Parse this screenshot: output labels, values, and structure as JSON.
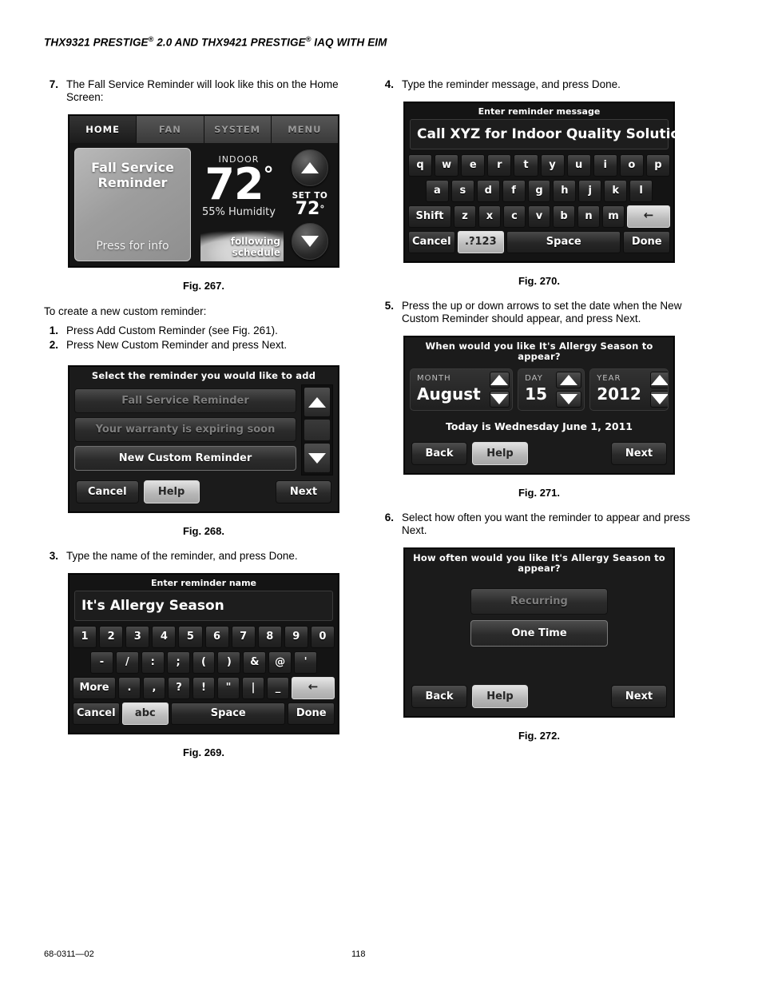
{
  "document": {
    "header": "THX9321 PRESTIGE® 2.0 AND THX9421 PRESTIGE® IAQ WITH EIM",
    "header_part1": "THX9321 PRESTIGE",
    "header_sup1": "®",
    "header_part2": " 2.0 AND THX9421 PRESTIGE",
    "header_sup2": "®",
    "header_part3": " IAQ WITH EIM",
    "footer_code": "68-0311—02",
    "page_number": "118"
  },
  "left_column": {
    "step7": {
      "num": "7.",
      "text": "The Fall Service Reminder will look like this on the Home Screen:"
    },
    "fig267_caption": "Fig. 267.",
    "intro": "To create a new custom reminder:",
    "step1": {
      "num": "1.",
      "text": "Press Add Custom Reminder (see Fig. 261)."
    },
    "step2": {
      "num": "2.",
      "text": "Press New Custom Reminder and press Next."
    },
    "fig268_caption": "Fig. 268.",
    "step3": {
      "num": "3.",
      "text": "Type the name of the reminder, and press Done."
    },
    "fig269_caption": "Fig. 269."
  },
  "right_column": {
    "step4": {
      "num": "4.",
      "text": "Type the reminder message, and press Done."
    },
    "fig270_caption": "Fig. 270.",
    "step5": {
      "num": "5.",
      "text": "Press the up or down arrows to set the date when the New Custom Reminder should appear, and press Next."
    },
    "fig271_caption": "Fig. 271.",
    "step6": {
      "num": "6.",
      "text": "Select how often you want the reminder to appear and press Next."
    },
    "fig272_caption": "Fig. 272."
  },
  "fig267_home_screen": {
    "tabs": [
      {
        "label": "HOME",
        "active": true
      },
      {
        "label": "FAN",
        "active": false
      },
      {
        "label": "SYSTEM",
        "active": false
      },
      {
        "label": "MENU",
        "active": false
      }
    ],
    "reminder_card": {
      "title_line1": "Fall Service",
      "title_line2": "Reminder",
      "action": "Press for info"
    },
    "indoor_label": "INDOOR",
    "temperature": "72",
    "degree": "°",
    "humidity": "55% Humidity",
    "schedule_status": "following schedule",
    "set_to_label": "SET TO",
    "set_to_value": "72",
    "set_to_degree": "°",
    "up_arrow_icon": "triangle-up-icon",
    "down_arrow_icon": "triangle-down-icon"
  },
  "fig268_select_reminder": {
    "title": "Select the reminder you would like to add",
    "items": [
      {
        "label": "Fall Service Reminder",
        "enabled": false
      },
      {
        "label": "Your warranty is expiring soon",
        "enabled": false
      },
      {
        "label": "New Custom Reminder",
        "enabled": true
      }
    ],
    "scroll_up_icon": "scroll-up-icon",
    "scroll_down_icon": "scroll-down-icon",
    "buttons": {
      "cancel": "Cancel",
      "help": "Help",
      "next": "Next"
    }
  },
  "fig269_enter_name": {
    "title": "Enter reminder name",
    "input_value": "It's Allergy Season",
    "rows": [
      [
        "1",
        "2",
        "3",
        "4",
        "5",
        "6",
        "7",
        "8",
        "9",
        "0"
      ],
      [
        "-",
        "/",
        ":",
        ";",
        "(",
        ")",
        "&",
        "@",
        "'"
      ],
      [
        ".",
        ",",
        "?",
        "!",
        "\"",
        "|",
        "_"
      ]
    ],
    "more_key": "More",
    "backspace_key": "←",
    "bottom": {
      "cancel": "Cancel",
      "mode": "abc",
      "space": "Space",
      "done": "Done"
    }
  },
  "fig270_enter_message": {
    "title": "Enter reminder message",
    "input_value": "Call XYZ for Indoor Quality Solutions",
    "rows": [
      [
        "q",
        "w",
        "e",
        "r",
        "t",
        "y",
        "u",
        "i",
        "o",
        "p"
      ],
      [
        "a",
        "s",
        "d",
        "f",
        "g",
        "h",
        "j",
        "k",
        "l"
      ],
      [
        "z",
        "x",
        "c",
        "v",
        "b",
        "n",
        "m"
      ]
    ],
    "shift_key": "Shift",
    "backspace_key": "←",
    "bottom": {
      "cancel": "Cancel",
      "mode": ".?123",
      "space": "Space",
      "done": "Done"
    }
  },
  "fig271_date_screen": {
    "title": "When would you like It's Allergy Season to appear?",
    "fields": [
      {
        "label": "MONTH",
        "value": "August"
      },
      {
        "label": "DAY",
        "value": "15"
      },
      {
        "label": "YEAR",
        "value": "2012"
      }
    ],
    "today_line": "Today is Wednesday June 1, 2011",
    "buttons": {
      "back": "Back",
      "help": "Help",
      "next": "Next"
    }
  },
  "fig272_frequency_screen": {
    "title": "How often would you like It's Allergy Season to appear?",
    "options": [
      {
        "label": "Recurring",
        "enabled": false
      },
      {
        "label": "One Time",
        "enabled": true
      }
    ],
    "buttons": {
      "back": "Back",
      "help": "Help",
      "next": "Next"
    }
  }
}
